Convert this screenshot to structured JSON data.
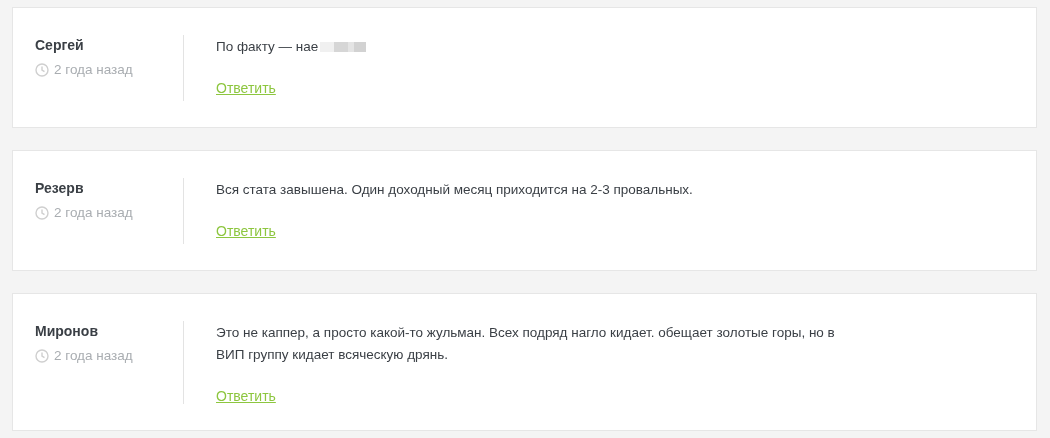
{
  "comments": [
    {
      "author": "Сергей",
      "time": "2 года назад",
      "text": "По факту — нае",
      "censored": true,
      "reply": "Ответить"
    },
    {
      "author": "Резерв",
      "time": "2 года назад",
      "text": "Вся стата завышена. Один доходный месяц приходится на 2-3 провальных.",
      "censored": false,
      "reply": "Ответить"
    },
    {
      "author": "Миронов",
      "time": "2 года назад",
      "text": "Это не каппер, а просто какой-то жульман. Всех подряд нагло кидает. обещает золотые горы, но в ВИП группу кидает всяческую дрянь.",
      "censored": false,
      "reply": "Ответить"
    }
  ]
}
